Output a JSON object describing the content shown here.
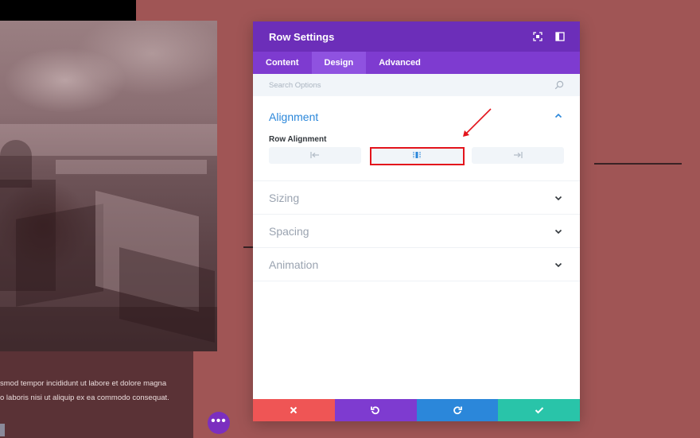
{
  "background": {
    "body_text_line1": "smod tempor incididunt ut labore et dolore magna",
    "body_text_line2": "o laboris nisi ut aliquip ex ea commodo consequat.",
    "dots_label": "•••"
  },
  "modal": {
    "title": "Row Settings",
    "header_icons": [
      "expand-icon",
      "split-view-icon"
    ],
    "tabs": [
      {
        "label": "Content",
        "active": false
      },
      {
        "label": "Design",
        "active": true
      },
      {
        "label": "Advanced",
        "active": false
      }
    ],
    "search": {
      "placeholder": "Search Options"
    },
    "sections": {
      "alignment": {
        "title": "Alignment",
        "expanded": true,
        "row_alignment_label": "Row Alignment",
        "options": [
          "left",
          "center",
          "right"
        ],
        "selected": "center"
      },
      "sizing": {
        "title": "Sizing",
        "expanded": false
      },
      "spacing": {
        "title": "Spacing",
        "expanded": false
      },
      "animation": {
        "title": "Animation",
        "expanded": false
      }
    },
    "footer": {
      "buttons": [
        "cancel",
        "undo",
        "redo",
        "save"
      ]
    }
  },
  "colors": {
    "purple_header": "#6c2eb9",
    "purple_tabs": "#7e3bd0",
    "accent_blue": "#2b87da",
    "cancel_red": "#ef5555",
    "save_green": "#29c4a9",
    "highlight_red": "#e3141c",
    "page_background": "#a05555"
  }
}
